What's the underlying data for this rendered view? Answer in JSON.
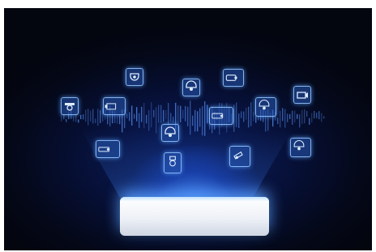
{
  "scene": {
    "background": "#040818",
    "accent": "#3c82ff",
    "device_color": "#ffffff",
    "icons": [
      "dome-camera-icon",
      "dome-camera-icon",
      "bullet-camera-icon",
      "box-camera-icon",
      "fisheye-camera-icon",
      "dome-camera-icon",
      "bullet-camera-icon",
      "box-camera-icon",
      "bullet-camera-icon",
      "dome-camera-icon",
      "ptz-camera-icon",
      "bullet-camera-icon",
      "dome-camera-icon"
    ]
  }
}
